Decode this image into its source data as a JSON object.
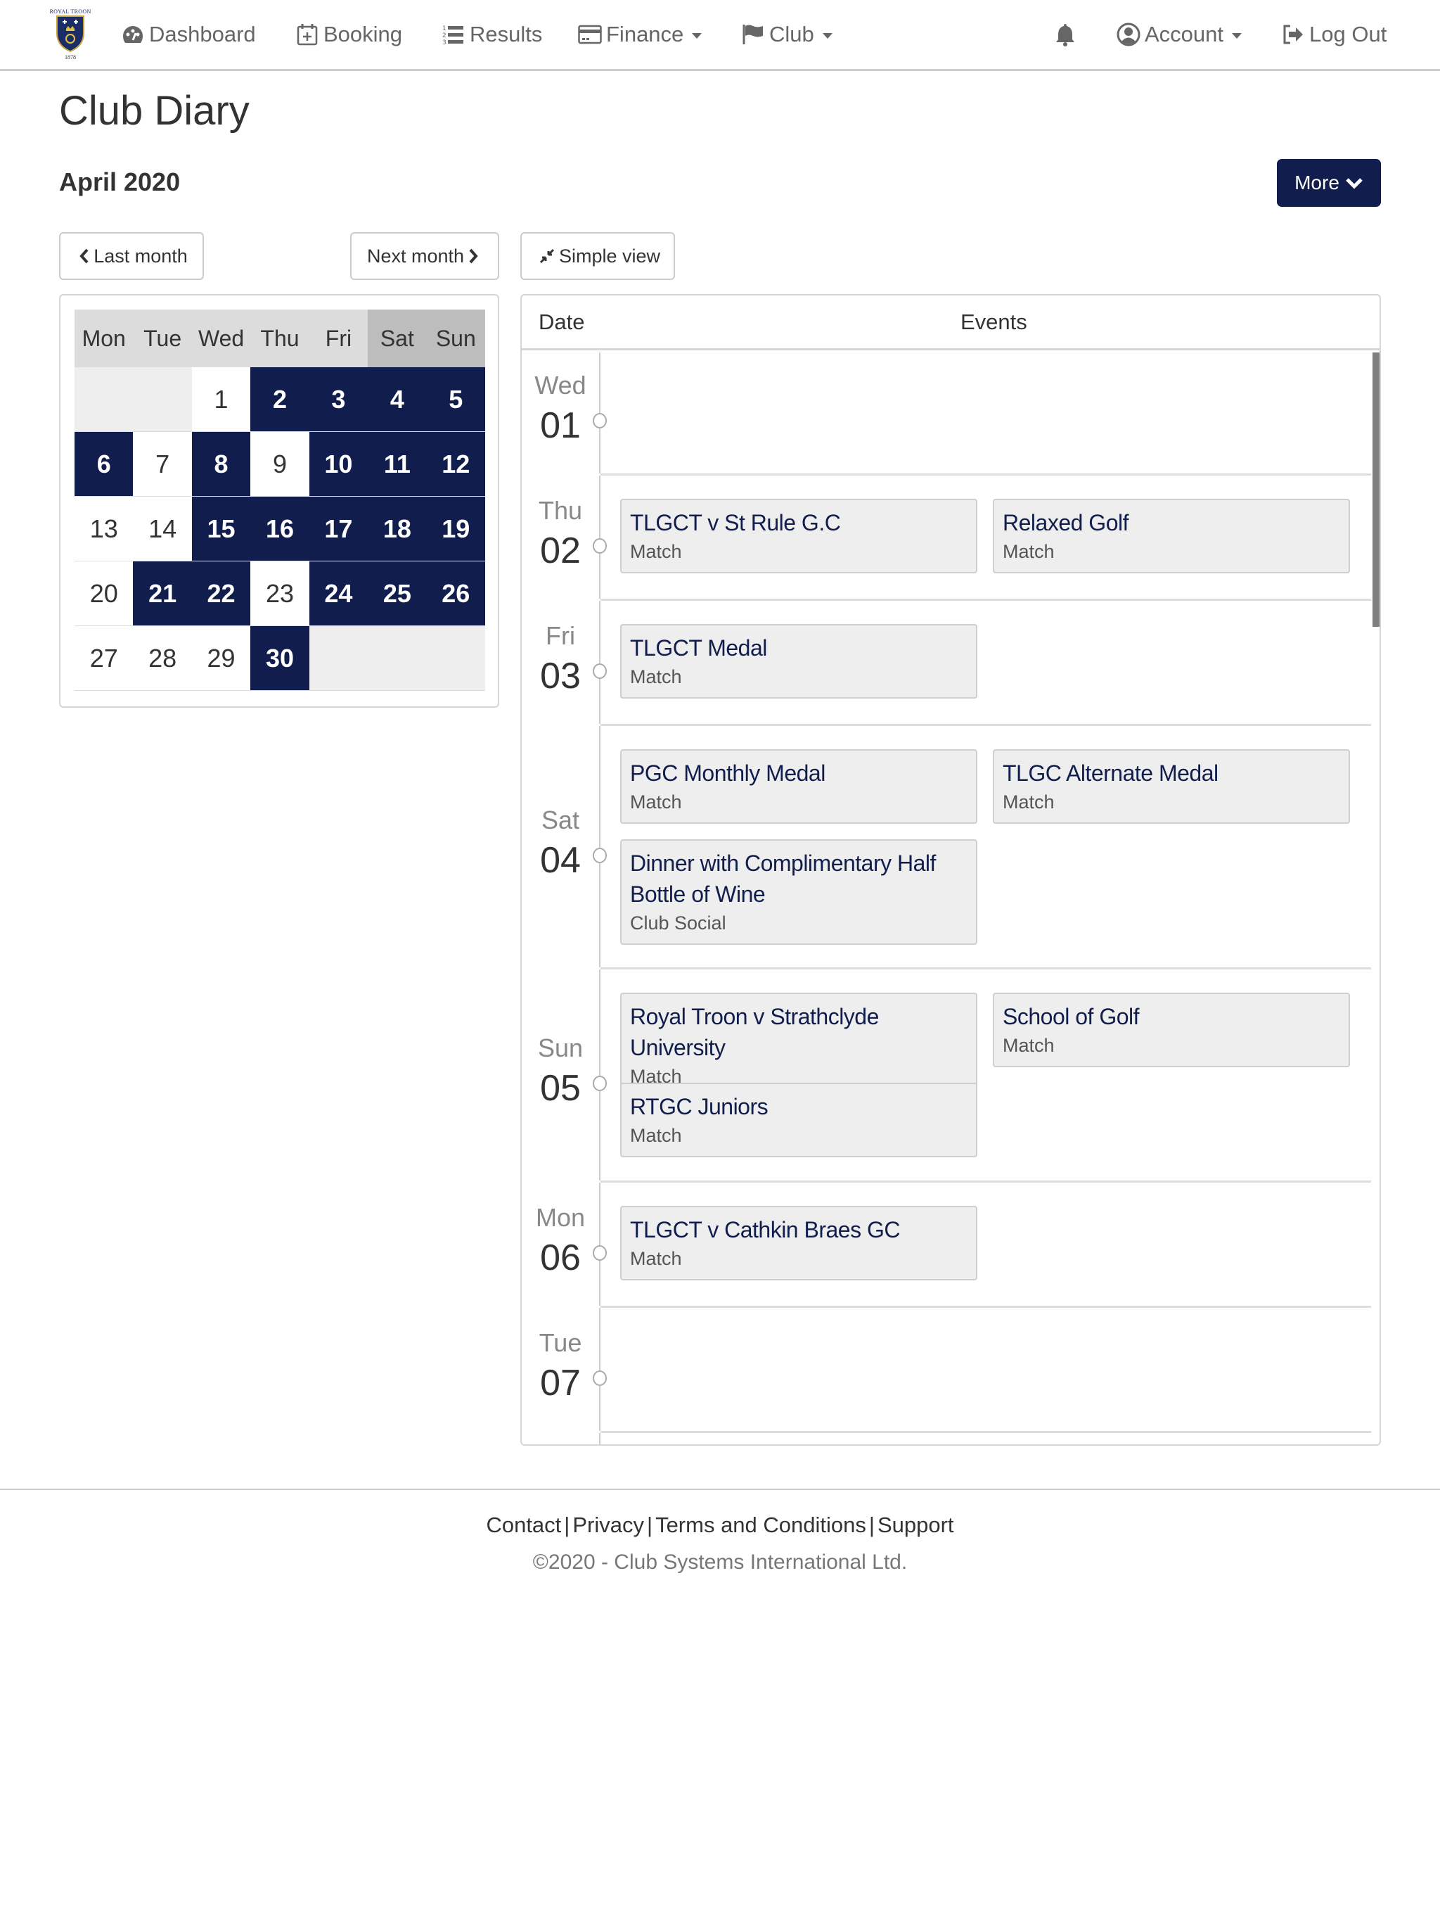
{
  "navbar": {
    "logo": {
      "top_text": "ROYAL TROON",
      "year": "1878"
    },
    "items": [
      {
        "label": "Dashboard",
        "icon": "dashboard-icon",
        "dropdown": false
      },
      {
        "label": "Booking",
        "icon": "calendar-plus-icon",
        "dropdown": false
      },
      {
        "label": "Results",
        "icon": "numbered-list-icon",
        "dropdown": false
      },
      {
        "label": "Finance",
        "icon": "credit-card-icon",
        "dropdown": true
      },
      {
        "label": "Club",
        "icon": "flag-icon",
        "dropdown": true
      }
    ],
    "right": {
      "notifications_icon": "bell-icon",
      "account_label": "Account",
      "logout_label": "Log Out"
    }
  },
  "page": {
    "title": "Club Diary",
    "month": "April 2020",
    "more_label": "More",
    "last_month_label": "Last month",
    "next_month_label": "Next month",
    "simple_view_label": "Simple view"
  },
  "calendar": {
    "weekdays": [
      "Mon",
      "Tue",
      "Wed",
      "Thu",
      "Fri",
      "Sat",
      "Sun"
    ],
    "weeks": [
      [
        null,
        null,
        {
          "d": "1",
          "ev": false
        },
        {
          "d": "2",
          "ev": true
        },
        {
          "d": "3",
          "ev": true
        },
        {
          "d": "4",
          "ev": true
        },
        {
          "d": "5",
          "ev": true
        }
      ],
      [
        {
          "d": "6",
          "ev": true
        },
        {
          "d": "7",
          "ev": false
        },
        {
          "d": "8",
          "ev": true
        },
        {
          "d": "9",
          "ev": false
        },
        {
          "d": "10",
          "ev": true
        },
        {
          "d": "11",
          "ev": true
        },
        {
          "d": "12",
          "ev": true
        }
      ],
      [
        {
          "d": "13",
          "ev": false
        },
        {
          "d": "14",
          "ev": false
        },
        {
          "d": "15",
          "ev": true
        },
        {
          "d": "16",
          "ev": true
        },
        {
          "d": "17",
          "ev": true
        },
        {
          "d": "18",
          "ev": true
        },
        {
          "d": "19",
          "ev": true
        }
      ],
      [
        {
          "d": "20",
          "ev": false
        },
        {
          "d": "21",
          "ev": true
        },
        {
          "d": "22",
          "ev": true
        },
        {
          "d": "23",
          "ev": false
        },
        {
          "d": "24",
          "ev": true
        },
        {
          "d": "25",
          "ev": true
        },
        {
          "d": "26",
          "ev": true
        }
      ],
      [
        {
          "d": "27",
          "ev": false
        },
        {
          "d": "28",
          "ev": false
        },
        {
          "d": "29",
          "ev": false
        },
        {
          "d": "30",
          "ev": true
        },
        null,
        null,
        null
      ]
    ]
  },
  "events_table": {
    "header_date": "Date",
    "header_events": "Events",
    "days": [
      {
        "day": "Wed",
        "num": "01",
        "events": []
      },
      {
        "day": "Thu",
        "num": "02",
        "events": [
          {
            "title": "TLGCT v St Rule G.C",
            "type": "Match"
          },
          {
            "title": "Relaxed Golf",
            "type": "Match"
          }
        ]
      },
      {
        "day": "Fri",
        "num": "03",
        "events": [
          {
            "title": "TLGCT Medal",
            "type": "Match"
          }
        ]
      },
      {
        "day": "Sat",
        "num": "04",
        "events": [
          {
            "title": "PGC Monthly Medal",
            "type": "Match"
          },
          {
            "title": "TLGC Alternate Medal",
            "type": "Match"
          },
          {
            "title": "Dinner with Complimentary Half Bottle of Wine",
            "type": "Club Social"
          }
        ]
      },
      {
        "day": "Sun",
        "num": "05",
        "events": [
          {
            "title": "Royal Troon v Strathclyde University",
            "type": "Match"
          },
          {
            "title": "School of Golf",
            "type": "Match"
          },
          {
            "title": "RTGC Juniors",
            "type": "Match"
          }
        ]
      },
      {
        "day": "Mon",
        "num": "06",
        "events": [
          {
            "title": "TLGCT v Cathkin Braes GC",
            "type": "Match"
          }
        ]
      },
      {
        "day": "Tue",
        "num": "07",
        "events": []
      }
    ]
  },
  "footer": {
    "links": [
      "Contact",
      "Privacy",
      "Terms and Conditions",
      "Support"
    ],
    "separator": "|",
    "copyright": "©2020 - Club Systems International Ltd."
  },
  "colors": {
    "brand_navy": "#111e4d",
    "empty_cell": "#eeeeee",
    "header_gray": "#dcdcdc",
    "weekend_header": "#bdbdbd"
  }
}
